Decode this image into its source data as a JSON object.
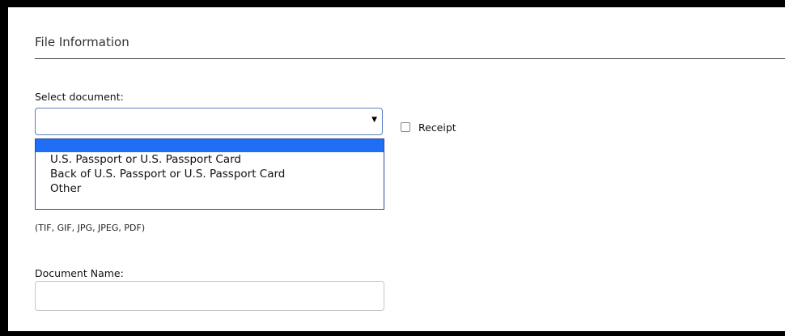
{
  "section": {
    "title": "File Information"
  },
  "document_select": {
    "label": "Select document:",
    "selected_value": "",
    "arrow": "▼",
    "options": [
      "",
      "U.S. Passport or U.S. Passport Card",
      "Back of U.S. Passport or U.S. Passport Card",
      "Other"
    ]
  },
  "receipt": {
    "label": "Receipt",
    "checked": false
  },
  "file_formats": "(TIF, GIF, JPG, JPEG, PDF)",
  "document_name": {
    "label": "Document Name:",
    "value": ""
  },
  "colors": {
    "accent": "#1e6ff5",
    "select_border": "#5b7fc6"
  }
}
